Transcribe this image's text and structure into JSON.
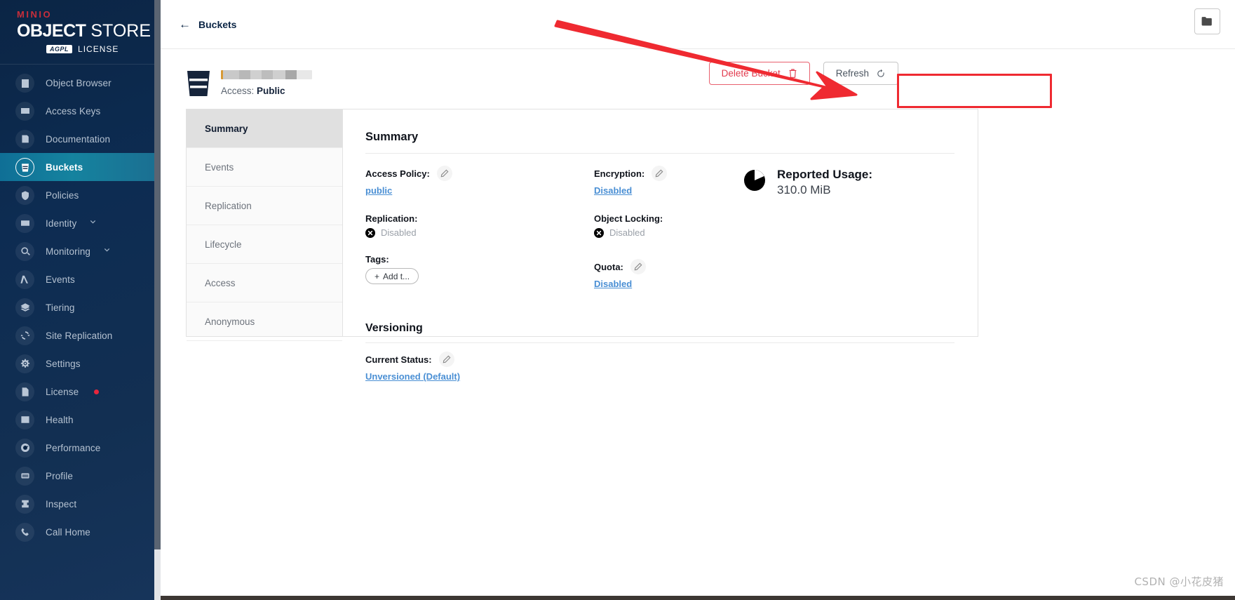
{
  "sidebar": {
    "logo": {
      "minio": "MINIO",
      "object": "OBJECT",
      "store": " STORE",
      "agpl_badge": "AGPL",
      "license_word": "LICENSE"
    },
    "items": [
      {
        "label": "Object Browser",
        "icon": "object-browser-icon",
        "active": false,
        "chevron": false,
        "dot": false
      },
      {
        "label": "Access Keys",
        "icon": "access-keys-icon",
        "active": false,
        "chevron": false,
        "dot": false
      },
      {
        "label": "Documentation",
        "icon": "documentation-icon",
        "active": false,
        "chevron": false,
        "dot": false
      },
      {
        "label": "Buckets",
        "icon": "buckets-icon",
        "active": true,
        "chevron": false,
        "dot": false
      },
      {
        "label": "Policies",
        "icon": "policies-icon",
        "active": false,
        "chevron": false,
        "dot": false
      },
      {
        "label": "Identity",
        "icon": "identity-icon",
        "active": false,
        "chevron": true,
        "dot": false
      },
      {
        "label": "Monitoring",
        "icon": "monitoring-icon",
        "active": false,
        "chevron": true,
        "dot": false
      },
      {
        "label": "Events",
        "icon": "events-lambda-icon",
        "active": false,
        "chevron": false,
        "dot": false
      },
      {
        "label": "Tiering",
        "icon": "tiering-icon",
        "active": false,
        "chevron": false,
        "dot": false
      },
      {
        "label": "Site Replication",
        "icon": "site-replication-icon",
        "active": false,
        "chevron": false,
        "dot": false
      },
      {
        "label": "Settings",
        "icon": "settings-gear-icon",
        "active": false,
        "chevron": false,
        "dot": false
      },
      {
        "label": "License",
        "icon": "license-icon",
        "active": false,
        "chevron": false,
        "dot": true
      },
      {
        "label": "Health",
        "icon": "health-icon",
        "active": false,
        "chevron": false,
        "dot": false
      },
      {
        "label": "Performance",
        "icon": "performance-icon",
        "active": false,
        "chevron": false,
        "dot": false
      },
      {
        "label": "Profile",
        "icon": "profile-icon",
        "active": false,
        "chevron": false,
        "dot": false
      },
      {
        "label": "Inspect",
        "icon": "inspect-icon",
        "active": false,
        "chevron": false,
        "dot": false
      },
      {
        "label": "Call Home",
        "icon": "call-home-icon",
        "active": false,
        "chevron": false,
        "dot": false
      }
    ]
  },
  "topbar": {
    "breadcrumb_label": "Buckets",
    "back_arrow": "←",
    "folder_button_icon": "folder-icon"
  },
  "bucket": {
    "name": "",
    "name_redacted": true,
    "access_label": "Access:",
    "access_value": "Public"
  },
  "actions": {
    "delete_label": "Delete Bucket",
    "delete_icon": "trash-icon",
    "refresh_label": "Refresh",
    "refresh_icon": "refresh-icon"
  },
  "tabs": [
    {
      "label": "Summary",
      "active": true
    },
    {
      "label": "Events",
      "active": false
    },
    {
      "label": "Replication",
      "active": false
    },
    {
      "label": "Lifecycle",
      "active": false
    },
    {
      "label": "Access",
      "active": false
    },
    {
      "label": "Anonymous",
      "active": false
    }
  ],
  "summary": {
    "title": "Summary",
    "access_policy": {
      "label": "Access Policy:",
      "value": "public",
      "editable": true
    },
    "replication": {
      "label": "Replication:",
      "value": "Disabled",
      "status": "disabled"
    },
    "tags": {
      "label": "Tags:",
      "add_label": "Add t...",
      "add_plus": "+"
    },
    "encryption": {
      "label": "Encryption:",
      "value": "Disabled",
      "editable": true
    },
    "object_locking": {
      "label": "Object Locking:",
      "value": "Disabled",
      "status": "disabled"
    },
    "quota": {
      "label": "Quota:",
      "value": "Disabled",
      "editable": true
    },
    "usage": {
      "title": "Reported Usage:",
      "value": "310.0 MiB",
      "icon": "pie-chart-icon"
    }
  },
  "versioning": {
    "title": "Versioning",
    "current_status_label": "Current Status:",
    "current_status_value": "Unversioned (Default)",
    "editable": true
  },
  "annotation": {
    "box_color": "#ef2a31",
    "arrow_color": "#ef2a31",
    "target": "delete-bucket-button"
  },
  "watermark": "CSDN @小花皮猪",
  "colors": {
    "sidebar_bg": "#0b2545",
    "active_nav": "#15839f",
    "danger": "#e23b4e",
    "link": "#4a8fd4",
    "text_dark": "#10141c"
  }
}
